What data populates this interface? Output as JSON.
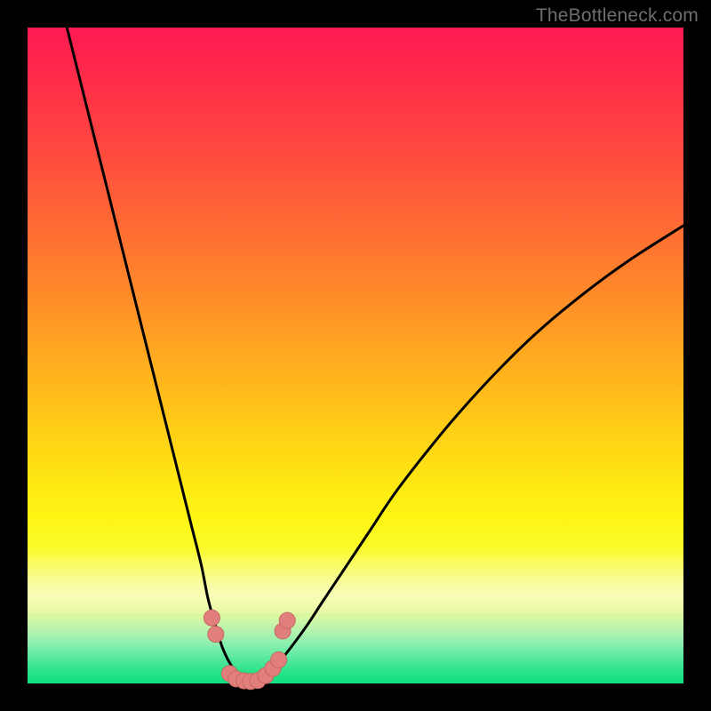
{
  "watermark": "TheBottleneck.com",
  "colors": {
    "background": "#000000",
    "curve": "#000000",
    "marker_fill": "#e07f7b",
    "marker_stroke": "#c96761"
  },
  "chart_data": {
    "type": "line",
    "title": "",
    "xlabel": "",
    "ylabel": "",
    "xlim": [
      0,
      100
    ],
    "ylim": [
      0,
      100
    ],
    "series": [
      {
        "name": "left-curve",
        "x": [
          6,
          8,
          10,
          12,
          14,
          16,
          18,
          20,
          22,
          23.5,
          25,
          26.5,
          27.5,
          28.6,
          29.7,
          30.9,
          32.2,
          33.5
        ],
        "y": [
          100,
          92,
          84,
          76,
          68,
          60,
          52,
          44,
          36,
          30,
          24,
          18,
          13,
          9,
          5.5,
          3,
          1.2,
          0.3
        ]
      },
      {
        "name": "right-curve",
        "x": [
          35,
          36.5,
          38,
          40,
          42.5,
          45,
          48,
          52,
          56,
          61,
          66,
          72,
          78,
          85,
          92,
          100
        ],
        "y": [
          0.3,
          1.2,
          2.8,
          5.3,
          8.7,
          12.5,
          17,
          23,
          29,
          35.5,
          41.5,
          48,
          53.8,
          59.6,
          64.7,
          69.8
        ]
      }
    ],
    "markers": [
      {
        "x": 28.1,
        "y": 10.0
      },
      {
        "x": 28.7,
        "y": 7.5
      },
      {
        "x": 30.8,
        "y": 1.5
      },
      {
        "x": 31.8,
        "y": 0.7
      },
      {
        "x": 33.0,
        "y": 0.4
      },
      {
        "x": 34.0,
        "y": 0.3
      },
      {
        "x": 35.1,
        "y": 0.45
      },
      {
        "x": 36.3,
        "y": 1.2
      },
      {
        "x": 37.4,
        "y": 2.3
      },
      {
        "x": 38.3,
        "y": 3.6
      },
      {
        "x": 38.9,
        "y": 8.0
      },
      {
        "x": 39.6,
        "y": 9.6
      }
    ],
    "marker_radius_px": 9
  }
}
